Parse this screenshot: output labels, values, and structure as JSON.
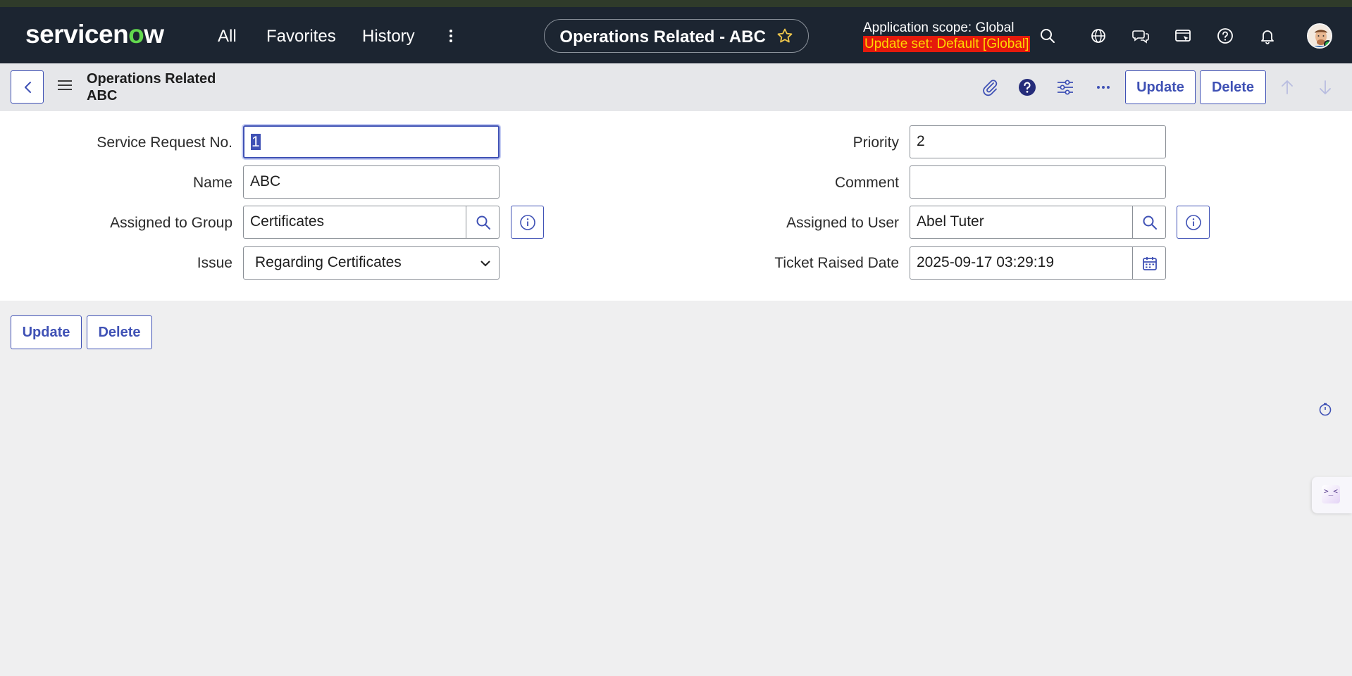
{
  "header": {
    "logo": {
      "pre": "servicen",
      "o": "o",
      "post": "w"
    },
    "nav": [
      "All",
      "Favorites",
      "History"
    ],
    "title": "Operations Related - ABC",
    "scope_label": "Application scope: Global",
    "update_set": "Update set: Default [Global]",
    "icons": [
      "search-icon",
      "globe-icon",
      "chat-icon",
      "screen-share-icon",
      "help-icon",
      "bell-icon"
    ]
  },
  "form_header": {
    "title_line1": "Operations Related",
    "title_line2": "ABC",
    "update_label": "Update",
    "delete_label": "Delete"
  },
  "form": {
    "service_request_no": {
      "label": "Service Request No.",
      "value": "1"
    },
    "name": {
      "label": "Name",
      "value": "ABC"
    },
    "assigned_group": {
      "label": "Assigned to Group",
      "value": "Certificates"
    },
    "issue": {
      "label": "Issue",
      "value": "Regarding Certificates"
    },
    "priority": {
      "label": "Priority",
      "value": "2"
    },
    "comment": {
      "label": "Comment",
      "value": ""
    },
    "assigned_user": {
      "label": "Assigned to User",
      "value": "Abel Tuter"
    },
    "ticket_raised_date": {
      "label": "Ticket Raised Date",
      "value": "2025-09-17 03:29:19"
    }
  },
  "footer_buttons": {
    "update_label": "Update",
    "delete_label": "Delete"
  },
  "colors": {
    "nav_bg": "#1c2531",
    "accent": "#3f51b5",
    "update_set_bg": "#e51a0c",
    "update_set_text": "#ffd700",
    "logo_green": "#62d84e"
  }
}
